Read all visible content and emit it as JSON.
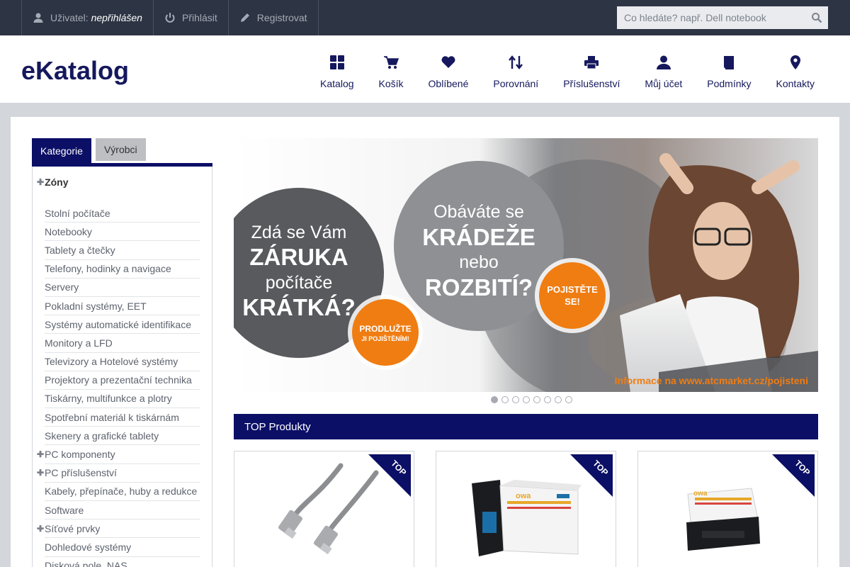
{
  "topbar": {
    "user_label": "Uživatel:",
    "user_value": "nepřihlášen",
    "login": "Přihlásit",
    "register": "Registrovat",
    "search_placeholder": "Co hledáte? např. Dell notebook",
    "icons": [
      "user-icon",
      "power-icon",
      "pencil-icon",
      "search-icon"
    ]
  },
  "header": {
    "logo": "eKatalog",
    "nav": [
      {
        "label": "Katalog",
        "icon": "grid-icon"
      },
      {
        "label": "Košík",
        "icon": "cart-icon"
      },
      {
        "label": "Oblíbené",
        "icon": "heart-icon"
      },
      {
        "label": "Porovnání",
        "icon": "sort-arrows-icon"
      },
      {
        "label": "Příslušenství",
        "icon": "printer-icon"
      },
      {
        "label": "Můj účet",
        "icon": "user-icon"
      },
      {
        "label": "Podmínky",
        "icon": "book-icon"
      },
      {
        "label": "Kontakty",
        "icon": "map-marker-icon"
      }
    ]
  },
  "sidebar": {
    "tabs": [
      "Kategorie",
      "Výrobci"
    ],
    "heading": "Zóny",
    "items": [
      {
        "label": "Stolní počítače"
      },
      {
        "label": "Notebooky"
      },
      {
        "label": "Tablety a čtečky"
      },
      {
        "label": "Telefony, hodinky a navigace"
      },
      {
        "label": "Servery"
      },
      {
        "label": "Pokladní systémy, EET"
      },
      {
        "label": "Systémy automatické identifikace"
      },
      {
        "label": "Monitory a LFD"
      },
      {
        "label": "Televizory a Hotelové systémy"
      },
      {
        "label": "Projektory a prezentační technika"
      },
      {
        "label": "Tiskárny, multifunkce a plotry"
      },
      {
        "label": "Spotřební materiál k tiskárnám"
      },
      {
        "label": "Skenery a grafické tablety"
      },
      {
        "label": "PC komponenty"
      },
      {
        "label": "PC příslušenství"
      },
      {
        "label": "Kabely, přepínače, huby a redukce"
      },
      {
        "label": "Software"
      },
      {
        "label": "Síťové prvky"
      },
      {
        "label": "Dohledové systémy"
      },
      {
        "label": "Disková pole, NAS"
      }
    ]
  },
  "banner": {
    "left_line1": "Zdá se Vám",
    "left_line2": "ZÁRUKA",
    "left_line3": "počítače",
    "left_line4": "KRÁTKÁ?",
    "left_button_line1": "PRODLUŽTE",
    "left_button_line2": "JI POJIŠTĚNÍM!",
    "mid_line1": "Obáváte se",
    "mid_line2": "KRÁDEŽE",
    "mid_line3": "nebo",
    "mid_line4": "ROZBITÍ?",
    "mid_button_line1": "POJISTĚTE",
    "mid_button_line2": "SE!",
    "footer": "Informace na www.atcmarket.cz/pojisteni",
    "slide_count": 8,
    "active_slide": 1,
    "colors": {
      "orange": "#f07d12",
      "dark_circle": "#585a5e",
      "mid_circle": "#8e9094"
    }
  },
  "top_products": {
    "title": "TOP Produkty",
    "badge": "TOP",
    "items": [
      {
        "image": "network-cable-image"
      },
      {
        "image": "toner-cartridge-image"
      },
      {
        "image": "laser-toner-image"
      }
    ]
  }
}
